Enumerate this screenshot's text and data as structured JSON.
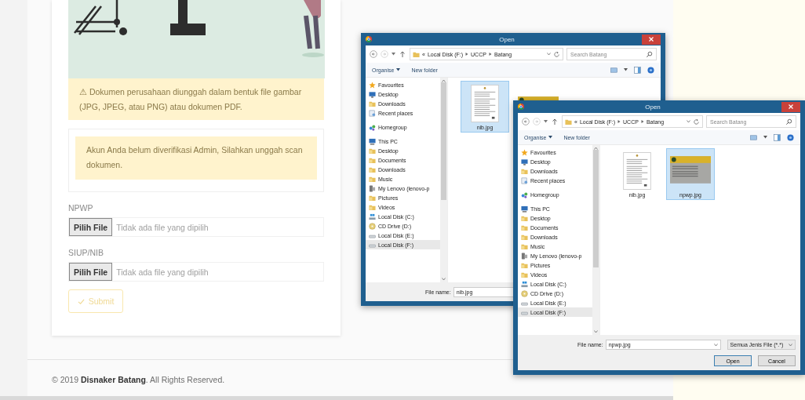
{
  "form": {
    "notice": "⚠ Dokumen perusahaan diunggah dalam bentuk file gambar (JPG, JPEG, atau PNG) atau dokumen PDF.",
    "alert": "Akun Anda belum diverifikasi Admin, Silahkan unggah scan dokumen.",
    "fields": [
      {
        "label": "NPWP",
        "button": "Pilih File",
        "status": "Tidak ada file yang dipilih"
      },
      {
        "label": "SIUP/NIB",
        "button": "Pilih File",
        "status": "Tidak ada file yang dipilih"
      }
    ],
    "submit": {
      "label": "Submit",
      "disabled": true
    }
  },
  "footer": {
    "text": "© 2019 **Disnaker Batang**. All Rights Reserved."
  },
  "dialogs": [
    {
      "title": "Open",
      "address": {
        "overflow": "«",
        "crumbs": [
          "Local Disk (F:)",
          "UCCP",
          "Batang"
        ]
      },
      "search_placeholder": "Search Batang",
      "toolbar": [
        "Organise",
        "New folder"
      ],
      "nav": [
        {
          "label": "Favourites",
          "kind": "star",
          "selected": false
        },
        {
          "label": "Desktop",
          "kind": "monitor",
          "selected": false
        },
        {
          "label": "Downloads",
          "kind": "folder",
          "selected": false
        },
        {
          "label": "Recent places",
          "kind": "recent",
          "selected": false
        },
        {
          "label": "Homegroup",
          "kind": "homegroup",
          "selected": false
        },
        {
          "label": "This PC",
          "kind": "pc",
          "selected": false
        },
        {
          "label": "Desktop",
          "kind": "folder",
          "selected": false
        },
        {
          "label": "Documents",
          "kind": "folder",
          "selected": false
        },
        {
          "label": "Downloads",
          "kind": "folder",
          "selected": false
        },
        {
          "label": "Music",
          "kind": "folder",
          "selected": false
        },
        {
          "label": "My Lenovo (lenovo-p",
          "kind": "device",
          "selected": false
        },
        {
          "label": "Pictures",
          "kind": "folder",
          "selected": false
        },
        {
          "label": "Videos",
          "kind": "folder",
          "selected": false
        },
        {
          "label": "Local Disk (C:)",
          "kind": "osdrive",
          "selected": false
        },
        {
          "label": "CD Drive (D:)",
          "kind": "cd",
          "selected": false
        },
        {
          "label": "Local Disk (E:)",
          "kind": "drive",
          "selected": false
        },
        {
          "label": "Local Disk (F:)",
          "kind": "drive",
          "selected": true
        }
      ],
      "files": [
        {
          "name": "nib.jpg",
          "kind": "document",
          "selected": true
        },
        {
          "kind": "card",
          "selected": false
        }
      ],
      "file_name_label": "File name:",
      "file_name": "nib.jpg"
    },
    {
      "title": "Open",
      "address": {
        "overflow": "«",
        "crumbs": [
          "Local Disk (F:)",
          "UCCP",
          "Batang"
        ]
      },
      "search_placeholder": "Search Batang",
      "toolbar": [
        "Organise",
        "New folder"
      ],
      "nav": [
        {
          "label": "Favourites",
          "kind": "star",
          "selected": false
        },
        {
          "label": "Desktop",
          "kind": "monitor",
          "selected": false
        },
        {
          "label": "Downloads",
          "kind": "folder",
          "selected": false
        },
        {
          "label": "Recent places",
          "kind": "recent",
          "selected": false
        },
        {
          "label": "Homegroup",
          "kind": "homegroup",
          "selected": false
        },
        {
          "label": "This PC",
          "kind": "pc",
          "selected": false
        },
        {
          "label": "Desktop",
          "kind": "folder",
          "selected": false
        },
        {
          "label": "Documents",
          "kind": "folder",
          "selected": false
        },
        {
          "label": "Downloads",
          "kind": "folder",
          "selected": false
        },
        {
          "label": "Music",
          "kind": "folder",
          "selected": false
        },
        {
          "label": "My Lenovo (lenovo-p",
          "kind": "device",
          "selected": false
        },
        {
          "label": "Pictures",
          "kind": "folder",
          "selected": false
        },
        {
          "label": "Videos",
          "kind": "folder",
          "selected": false
        },
        {
          "label": "Local Disk (C:)",
          "kind": "osdrive",
          "selected": false
        },
        {
          "label": "CD Drive (D:)",
          "kind": "cd",
          "selected": false
        },
        {
          "label": "Local Disk (E:)",
          "kind": "drive",
          "selected": false
        },
        {
          "label": "Local Disk (F:)",
          "kind": "drive",
          "selected": true
        }
      ],
      "files": [
        {
          "name": "nib.jpg",
          "kind": "document",
          "selected": false
        },
        {
          "name": "npwp.jpg",
          "kind": "card",
          "selected": true
        }
      ],
      "file_name_label": "File name:",
      "file_name": "npwp.jpg",
      "file_type": "Semua Jenis File (*.*)",
      "buttons": [
        "Open",
        "Cancel"
      ]
    }
  ]
}
